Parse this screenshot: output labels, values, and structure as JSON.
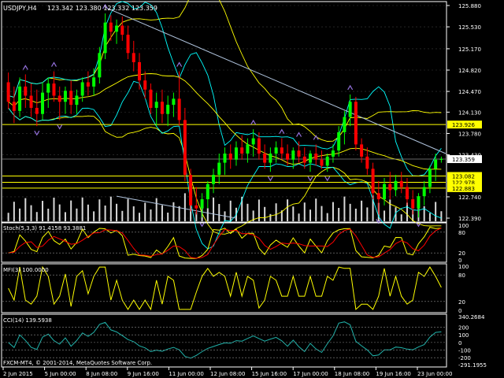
{
  "header": {
    "symbol": "USDJPY,H4",
    "ohlc": "123.342 123.380 123.332 123.359"
  },
  "price_axis": {
    "labels": [
      "125.880",
      "125.530",
      "125.170",
      "124.820",
      "124.470",
      "124.130",
      "123.780",
      "123.430",
      "122.740",
      "122.390"
    ],
    "tags": [
      {
        "text": "123.926",
        "color": "#ffff00",
        "text_color": "#000000"
      },
      {
        "text": "123.359",
        "color": "#ffffff",
        "text_color": "#000000"
      },
      {
        "text": "123.082",
        "color": "#ffff00",
        "text_color": "#000000"
      },
      {
        "text": "122.978",
        "color": "#ffff00",
        "text_color": "#000000"
      },
      {
        "text": "122.883",
        "color": "#ffff00",
        "text_color": "#000000"
      }
    ]
  },
  "stoch": {
    "label": "Stoch(5,3,3) 91.4158 93.3881",
    "axis": [
      "100",
      "80",
      "20",
      "0"
    ]
  },
  "mfi": {
    "label": "MFI(3) 100.0000",
    "axis": [
      "100",
      "80",
      "20",
      "0"
    ]
  },
  "cci": {
    "label": "CCI(14) 139.5938",
    "axis": [
      "340.2684",
      "200",
      "100",
      "0",
      "-100",
      "-200",
      "-291.1955"
    ]
  },
  "time_axis": [
    "2 Jun 2015",
    "5 Jun 00:00",
    "8 Jun 08:00",
    "9 Jun 16:00",
    "11 Jun 00:00",
    "12 Jun 08:00",
    "15 Jun 16:00",
    "17 Jun 00:00",
    "18 Jun 08:00",
    "19 Jun 16:00",
    "23 Jun 00:00"
  ],
  "copyright": "FXCM-MT4, © 2001-2014, MetaQuotes Software Corp.",
  "colors": {
    "bull": "#00ff00",
    "bear": "#ff0000",
    "band_yellow": "#ffff00",
    "band_cyan": "#00ffff",
    "grid": "#8c8c8c",
    "text": "#ffffff",
    "stoch_main": "#ffff00",
    "stoch_signal": "#ff0000",
    "mfi": "#ffff00",
    "cci": "#20b2aa",
    "fractal": "#9370db"
  },
  "chart_data": {
    "type": "candlestick",
    "symbol": "USDJPY",
    "timeframe": "H4",
    "ylim": [
      122.39,
      125.88
    ],
    "candles_approx": [
      {
        "o": 124.62,
        "h": 124.78,
        "l": 124.18,
        "c": 124.3
      },
      {
        "o": 124.3,
        "h": 124.55,
        "l": 123.95,
        "c": 124.15
      },
      {
        "o": 124.15,
        "h": 124.7,
        "l": 124.05,
        "c": 124.55
      },
      {
        "o": 124.55,
        "h": 124.75,
        "l": 124.2,
        "c": 124.4
      },
      {
        "o": 124.4,
        "h": 124.6,
        "l": 124.05,
        "c": 124.2
      },
      {
        "o": 124.2,
        "h": 124.5,
        "l": 123.9,
        "c": 124.1
      },
      {
        "o": 124.1,
        "h": 124.62,
        "l": 124.0,
        "c": 124.45
      },
      {
        "o": 124.45,
        "h": 124.7,
        "l": 124.2,
        "c": 124.6
      },
      {
        "o": 124.6,
        "h": 124.8,
        "l": 124.3,
        "c": 124.4
      },
      {
        "o": 124.4,
        "h": 124.55,
        "l": 124.0,
        "c": 124.3
      },
      {
        "o": 124.3,
        "h": 124.55,
        "l": 124.1,
        "c": 124.48
      },
      {
        "o": 124.48,
        "h": 124.65,
        "l": 124.1,
        "c": 124.25
      },
      {
        "o": 124.25,
        "h": 124.5,
        "l": 124.1,
        "c": 124.4
      },
      {
        "o": 124.4,
        "h": 124.7,
        "l": 124.3,
        "c": 124.62
      },
      {
        "o": 124.62,
        "h": 124.8,
        "l": 124.4,
        "c": 124.55
      },
      {
        "o": 124.55,
        "h": 124.85,
        "l": 124.4,
        "c": 124.7
      },
      {
        "o": 124.7,
        "h": 125.2,
        "l": 124.6,
        "c": 125.1
      },
      {
        "o": 125.1,
        "h": 125.75,
        "l": 125.0,
        "c": 125.6
      },
      {
        "o": 125.6,
        "h": 125.72,
        "l": 125.3,
        "c": 125.45
      },
      {
        "o": 125.45,
        "h": 125.65,
        "l": 125.25,
        "c": 125.55
      },
      {
        "o": 125.55,
        "h": 125.7,
        "l": 125.3,
        "c": 125.4
      },
      {
        "o": 125.4,
        "h": 125.55,
        "l": 125.0,
        "c": 125.1
      },
      {
        "o": 125.1,
        "h": 125.3,
        "l": 124.8,
        "c": 124.95
      },
      {
        "o": 124.95,
        "h": 125.1,
        "l": 124.5,
        "c": 124.65
      },
      {
        "o": 124.65,
        "h": 124.8,
        "l": 124.35,
        "c": 124.5
      },
      {
        "o": 124.5,
        "h": 124.6,
        "l": 124.1,
        "c": 124.2
      },
      {
        "o": 124.2,
        "h": 124.45,
        "l": 123.9,
        "c": 124.3
      },
      {
        "o": 124.3,
        "h": 124.5,
        "l": 123.95,
        "c": 124.1
      },
      {
        "o": 124.1,
        "h": 124.4,
        "l": 123.9,
        "c": 124.25
      },
      {
        "o": 124.25,
        "h": 124.45,
        "l": 124.05,
        "c": 124.35
      },
      {
        "o": 124.35,
        "h": 124.8,
        "l": 123.9,
        "c": 124.0
      },
      {
        "o": 124.0,
        "h": 124.2,
        "l": 123.0,
        "c": 123.1
      },
      {
        "o": 123.1,
        "h": 123.2,
        "l": 122.5,
        "c": 122.6
      },
      {
        "o": 122.6,
        "h": 122.9,
        "l": 122.45,
        "c": 122.55
      },
      {
        "o": 122.55,
        "h": 122.8,
        "l": 122.4,
        "c": 122.7
      },
      {
        "o": 122.7,
        "h": 123.0,
        "l": 122.55,
        "c": 122.95
      },
      {
        "o": 122.95,
        "h": 123.2,
        "l": 122.8,
        "c": 123.1
      },
      {
        "o": 123.1,
        "h": 123.45,
        "l": 122.95,
        "c": 123.3
      },
      {
        "o": 123.3,
        "h": 123.55,
        "l": 123.1,
        "c": 123.45
      },
      {
        "o": 123.45,
        "h": 123.6,
        "l": 123.2,
        "c": 123.35
      },
      {
        "o": 123.35,
        "h": 123.65,
        "l": 123.25,
        "c": 123.55
      },
      {
        "o": 123.55,
        "h": 123.75,
        "l": 123.35,
        "c": 123.45
      },
      {
        "o": 123.45,
        "h": 123.7,
        "l": 123.3,
        "c": 123.6
      },
      {
        "o": 123.6,
        "h": 123.85,
        "l": 123.4,
        "c": 123.7
      },
      {
        "o": 123.7,
        "h": 123.8,
        "l": 123.35,
        "c": 123.45
      },
      {
        "o": 123.45,
        "h": 123.6,
        "l": 123.2,
        "c": 123.3
      },
      {
        "o": 123.3,
        "h": 123.55,
        "l": 123.15,
        "c": 123.45
      },
      {
        "o": 123.45,
        "h": 123.65,
        "l": 123.3,
        "c": 123.55
      },
      {
        "o": 123.55,
        "h": 123.7,
        "l": 123.35,
        "c": 123.45
      },
      {
        "o": 123.45,
        "h": 123.6,
        "l": 123.25,
        "c": 123.35
      },
      {
        "o": 123.35,
        "h": 123.55,
        "l": 123.2,
        "c": 123.5
      },
      {
        "o": 123.5,
        "h": 123.65,
        "l": 123.3,
        "c": 123.4
      },
      {
        "o": 123.4,
        "h": 123.55,
        "l": 123.2,
        "c": 123.3
      },
      {
        "o": 123.3,
        "h": 123.5,
        "l": 123.15,
        "c": 123.45
      },
      {
        "o": 123.45,
        "h": 123.6,
        "l": 123.25,
        "c": 123.35
      },
      {
        "o": 123.35,
        "h": 123.5,
        "l": 123.2,
        "c": 123.25
      },
      {
        "o": 123.25,
        "h": 123.45,
        "l": 123.15,
        "c": 123.4
      },
      {
        "o": 123.4,
        "h": 123.6,
        "l": 123.3,
        "c": 123.5
      },
      {
        "o": 123.5,
        "h": 123.9,
        "l": 123.4,
        "c": 123.8
      },
      {
        "o": 123.8,
        "h": 124.15,
        "l": 123.6,
        "c": 124.05
      },
      {
        "o": 124.05,
        "h": 124.42,
        "l": 123.9,
        "c": 124.3
      },
      {
        "o": 124.3,
        "h": 124.38,
        "l": 123.5,
        "c": 123.6
      },
      {
        "o": 123.6,
        "h": 123.7,
        "l": 123.3,
        "c": 123.4
      },
      {
        "o": 123.4,
        "h": 123.55,
        "l": 123.1,
        "c": 123.2
      },
      {
        "o": 123.2,
        "h": 123.3,
        "l": 122.7,
        "c": 122.8
      },
      {
        "o": 122.8,
        "h": 123.0,
        "l": 122.45,
        "c": 122.7
      },
      {
        "o": 122.7,
        "h": 123.05,
        "l": 122.6,
        "c": 122.95
      },
      {
        "o": 122.95,
        "h": 123.15,
        "l": 122.7,
        "c": 122.85
      },
      {
        "o": 122.85,
        "h": 123.1,
        "l": 122.75,
        "c": 123.0
      },
      {
        "o": 123.0,
        "h": 123.15,
        "l": 122.8,
        "c": 122.9
      },
      {
        "o": 122.9,
        "h": 123.05,
        "l": 122.6,
        "c": 122.7
      },
      {
        "o": 122.7,
        "h": 122.85,
        "l": 122.45,
        "c": 122.55
      },
      {
        "o": 122.55,
        "h": 122.8,
        "l": 122.4,
        "c": 122.75
      },
      {
        "o": 122.75,
        "h": 123.0,
        "l": 122.6,
        "c": 122.9
      },
      {
        "o": 122.9,
        "h": 123.25,
        "l": 122.8,
        "c": 123.2
      },
      {
        "o": 123.2,
        "h": 123.45,
        "l": 123.0,
        "c": 123.35
      },
      {
        "o": 123.35,
        "h": 123.4,
        "l": 123.3,
        "c": 123.36
      }
    ]
  }
}
